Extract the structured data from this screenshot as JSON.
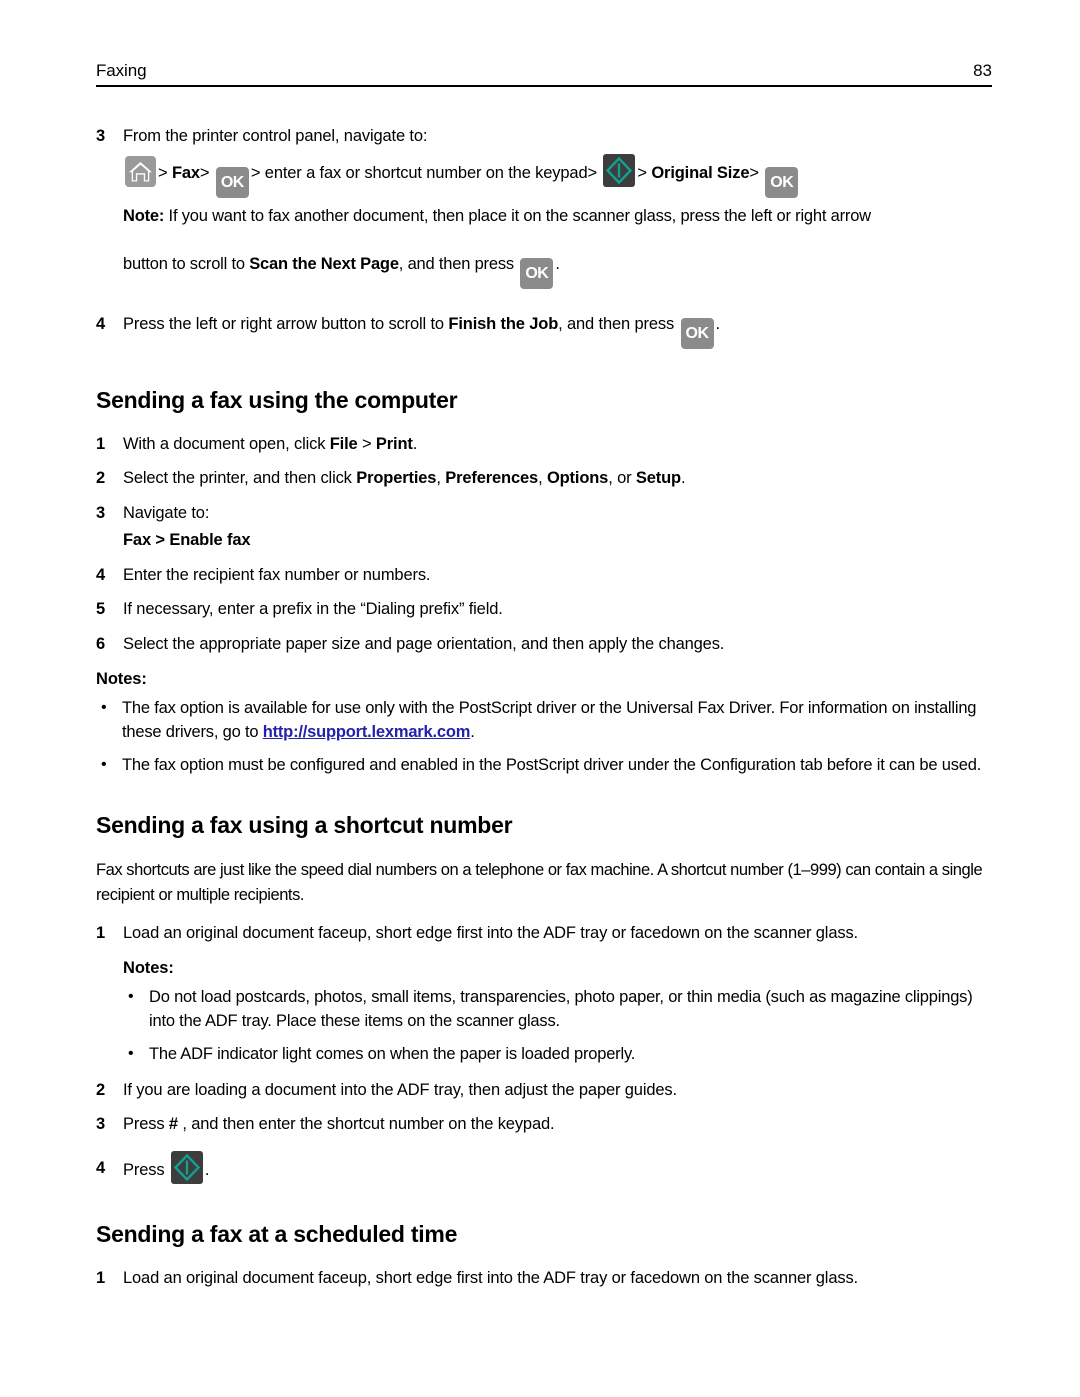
{
  "header": {
    "title": "Faxing",
    "page_number": "83"
  },
  "icons": {
    "home": "home-icon",
    "ok": "OK",
    "submit": "submit-icon"
  },
  "top_steps": {
    "step3_num": "3",
    "step3_text": "From the printer control panel, navigate to:",
    "nav": {
      "sep1": ">",
      "fax": "Fax",
      "sep2": ">",
      "sep3": ">",
      "middle": "enter a fax or shortcut number on the keypad",
      "sep4": ">",
      "sep5": ">",
      "original_size": "Original Size",
      "sep6": ">"
    },
    "note_label": "Note:",
    "note_line1": " If you want to fax another document, then place it on the scanner glass, press the left or right arrow",
    "note_line2_a": "button to scroll to ",
    "note_line2_b": "Scan the Next Page",
    "note_line2_c": ", and then press ",
    "note_line2_d": ".",
    "step4_num": "4",
    "step4_a": "Press the left or right arrow button to scroll to ",
    "step4_b": "Finish the Job",
    "step4_c": ", and then press ",
    "step4_d": "."
  },
  "section_computer": {
    "heading": "Sending a fax using the computer",
    "steps": [
      {
        "num": "1",
        "parts": [
          {
            "t": "With a document open, click ",
            "b": false
          },
          {
            "t": "File",
            "b": true
          },
          {
            "t": " > ",
            "b": false
          },
          {
            "t": "Print",
            "b": true
          },
          {
            "t": ".",
            "b": false
          }
        ]
      },
      {
        "num": "2",
        "parts": [
          {
            "t": "Select the printer, and then click ",
            "b": false
          },
          {
            "t": "Properties",
            "b": true
          },
          {
            "t": ", ",
            "b": false
          },
          {
            "t": "Preferences",
            "b": true
          },
          {
            "t": ", ",
            "b": false
          },
          {
            "t": "Options",
            "b": true
          },
          {
            "t": ", or ",
            "b": false
          },
          {
            "t": "Setup",
            "b": true
          },
          {
            "t": ".",
            "b": false
          }
        ]
      },
      {
        "num": "3",
        "parts": [
          {
            "t": "Navigate to:",
            "b": false
          }
        ]
      }
    ],
    "nav_path_a": "Fax",
    "nav_path_sep": " > ",
    "nav_path_b": "Enable fax",
    "steps_after": [
      {
        "num": "4",
        "text": "Enter the recipient fax number or numbers."
      },
      {
        "num": "5",
        "text": "If necessary, enter a prefix in the “Dialing prefix” field."
      },
      {
        "num": "6",
        "text": "Select the appropriate paper size and page orientation, and then apply the changes."
      }
    ],
    "notes_label": "Notes:",
    "notes": [
      {
        "pre": "The fax option is available for use only with the PostScript driver or the Universal Fax Driver. For information on installing these drivers, go to ",
        "link": "http://support.lexmark.com",
        "post": "."
      },
      {
        "pre": "The fax option must be configured and enabled in the PostScript driver under the Configuration tab before it can be used.",
        "link": "",
        "post": ""
      }
    ]
  },
  "section_shortcut": {
    "heading": "Sending a fax using a shortcut number",
    "intro": "Fax shortcuts are just like the speed dial numbers on a telephone or fax machine. A shortcut number (1–999) can contain a single recipient or multiple recipients.",
    "step1_num": "1",
    "step1_text": "Load an original document faceup, short edge first into the ADF tray or facedown on the scanner glass.",
    "notes_label": "Notes:",
    "notes": [
      "Do not load postcards, photos, small items, transparencies, photo paper, or thin media (such as magazine clippings) into the ADF tray. Place these items on the scanner glass.",
      "The ADF indicator light comes on when the paper is loaded properly."
    ],
    "steps_after": [
      {
        "num": "2",
        "text": "If you are loading a document into the ADF tray, then adjust the paper guides."
      }
    ],
    "step3_num": "3",
    "step3_a": "Press ",
    "step3_b": "#",
    "step3_c": " , and then enter the shortcut number on the keypad.",
    "step4_num": "4",
    "step4_a": "Press ",
    "step4_b": "."
  },
  "section_scheduled": {
    "heading": "Sending a fax at a scheduled time",
    "step1_num": "1",
    "step1_text": "Load an original document faceup, short edge first into the ADF tray or facedown on the scanner glass."
  }
}
